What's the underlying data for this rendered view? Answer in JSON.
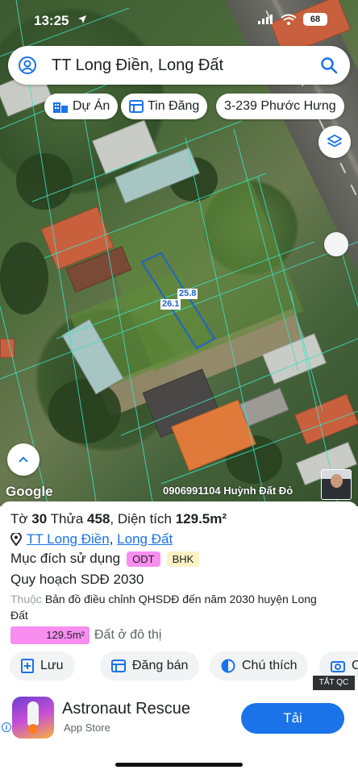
{
  "status_bar": {
    "time": "13:25",
    "battery": "68"
  },
  "search": {
    "value": "TT Long Điền, Long Đất"
  },
  "chips": [
    {
      "label": "Dự Án",
      "icon": "bank-icon"
    },
    {
      "label": "Tin Đăng",
      "icon": "listing-icon"
    },
    {
      "label": "3-239 Phước Hưng",
      "icon": ""
    }
  ],
  "map": {
    "dimensions": [
      "25.8",
      "26.1"
    ],
    "attribution": "Google",
    "watermark": "0906991104 Huỳnh Đất Đỏ"
  },
  "parcel": {
    "sheet_label": "Tờ",
    "sheet": "30",
    "lot_label": "Thửa",
    "lot": "458",
    "area_label": "Diện tích",
    "area": "129.5m²",
    "location_town": "TT Long Điền",
    "location_district": "Long Đất",
    "location_separator": ",",
    "purpose_label": "Mục đích sử dụng",
    "purpose_tags": [
      "ODT",
      "BHK"
    ],
    "plan_label": "Quy hoạch SDĐ 2030",
    "map_prefix": "Thuộc",
    "map_name": "Bản đồ điều chỉnh QHSDĐ đến năm 2030 huyện Long Đất",
    "area_bar_value": "129.5m²",
    "area_bar_label": "Đất ở đô thị",
    "area_bar_color": "#f78ef0"
  },
  "actions": [
    {
      "label": "Lưu",
      "icon": "save-icon"
    },
    {
      "label": "Đăng bán",
      "icon": "listing-icon"
    },
    {
      "label": "Chú thích",
      "icon": "legend-icon"
    },
    {
      "label": "C",
      "icon": "camera-icon"
    }
  ],
  "ad": {
    "close_label": "TẮT QC",
    "app_name": "Astronaut Rescue",
    "store": "App Store",
    "install_label": "Tải",
    "accent_color": "#1a73e8"
  }
}
